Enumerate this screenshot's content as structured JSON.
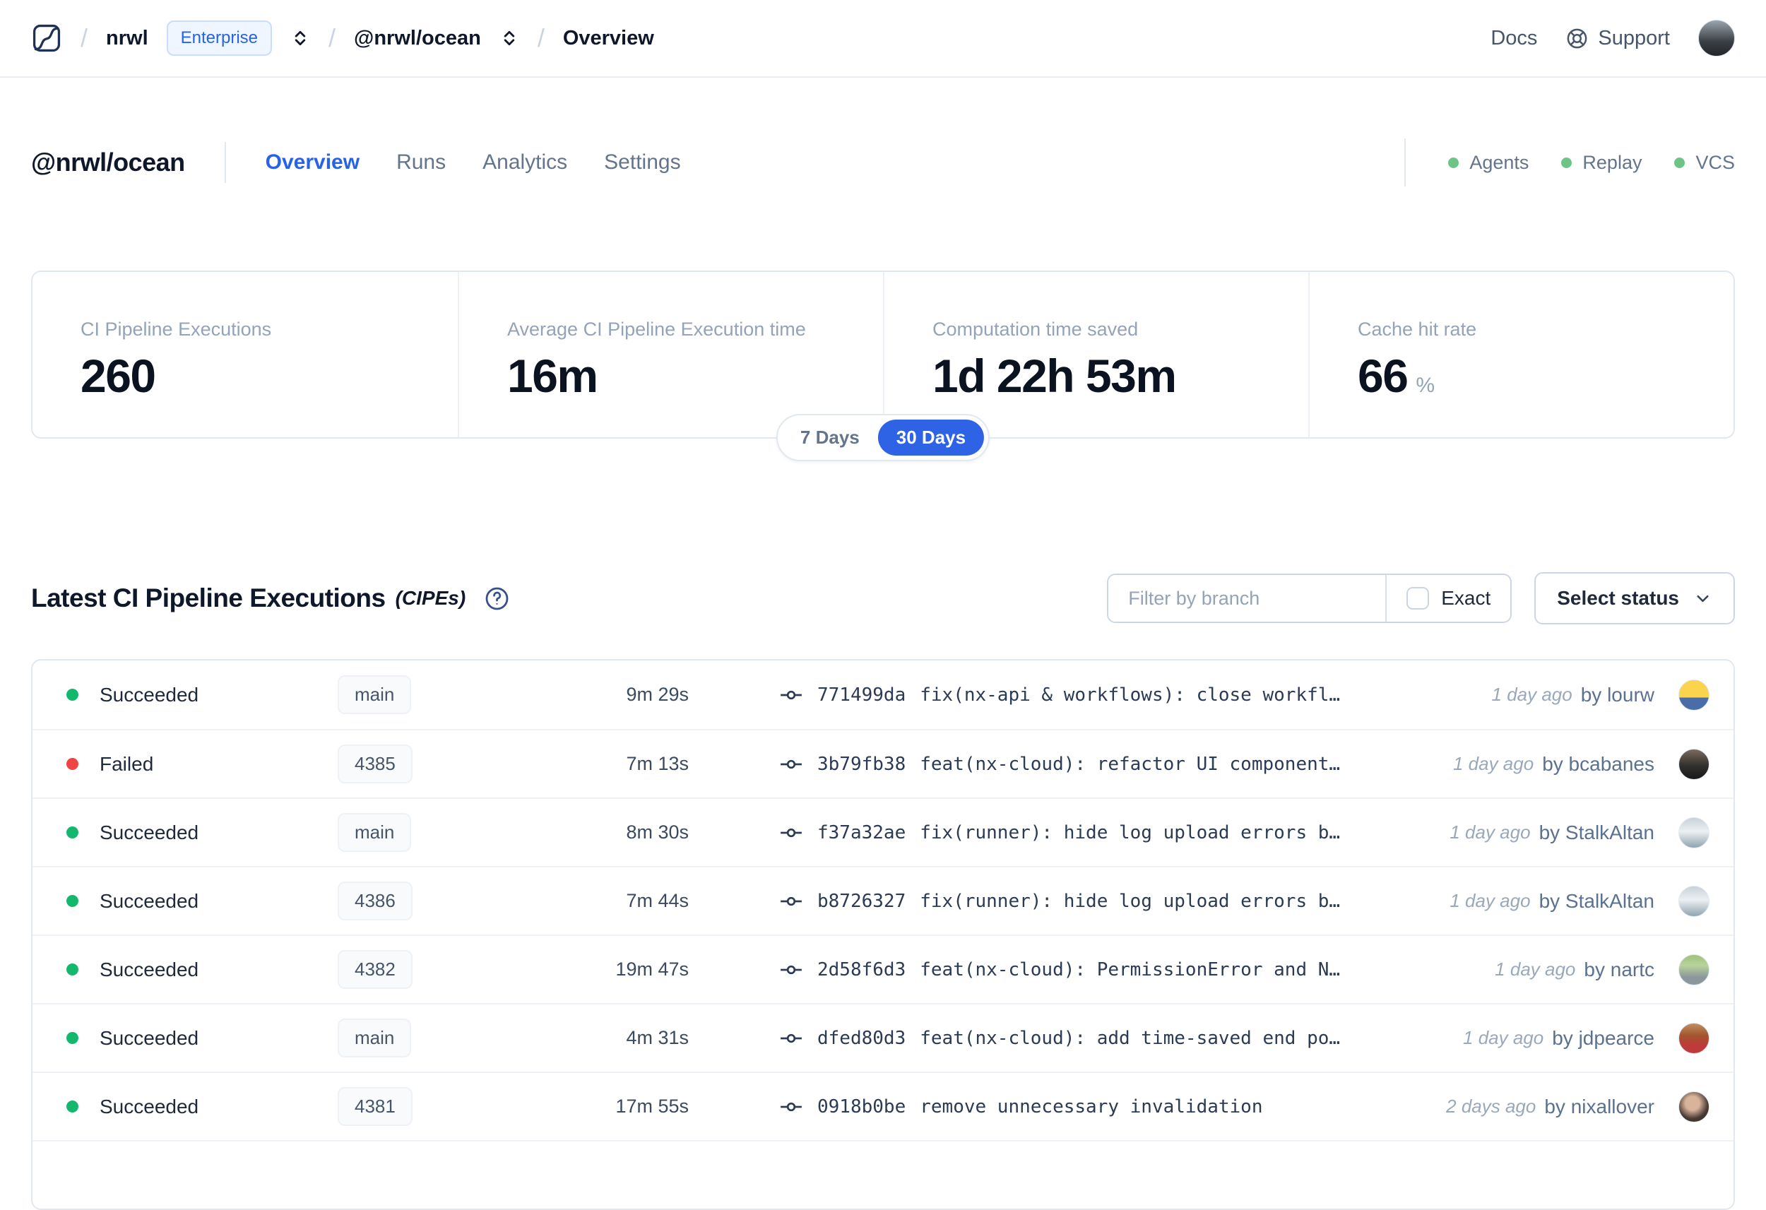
{
  "topbar": {
    "org": "nrwl",
    "org_badge": "Enterprise",
    "workspace": "@nrwl/ocean",
    "page": "Overview",
    "docs": "Docs",
    "support": "Support"
  },
  "header": {
    "title": "@nrwl/ocean",
    "tabs": [
      {
        "label": "Overview"
      },
      {
        "label": "Runs"
      },
      {
        "label": "Analytics"
      },
      {
        "label": "Settings"
      }
    ],
    "badges": [
      {
        "label": "Agents"
      },
      {
        "label": "Replay"
      },
      {
        "label": "VCS"
      }
    ],
    "badge_dot_color": "#6ec487"
  },
  "stats": {
    "cards": [
      {
        "label": "CI Pipeline Executions",
        "value": "260"
      },
      {
        "label": "Average CI Pipeline Execution time",
        "value": "16m"
      },
      {
        "label": "Computation time saved",
        "value": "1d 22h 53m"
      },
      {
        "label": "Cache hit rate",
        "value": "66",
        "suffix": "%"
      }
    ],
    "toggle": {
      "options": [
        "7 Days",
        "30 Days"
      ],
      "selected": "30 Days"
    }
  },
  "cipe": {
    "title": "Latest CI Pipeline Executions",
    "subtitle": "(CIPEs)",
    "filter_placeholder": "Filter by branch",
    "exact": "Exact",
    "select_status": "Select status",
    "rows": [
      {
        "status": "Succeeded",
        "dot_color": "#14b86d",
        "branch": "main",
        "duration": "9m 29s",
        "hash": "771499da",
        "message": "fix(nx-api & workflows): close workfl…",
        "time_ago": "1 day ago",
        "author": "by lourw",
        "avatar_bg": "linear-gradient(180deg,#fcd34d 58%,#4a6da7 58%)"
      },
      {
        "status": "Failed",
        "dot_color": "#ef4444",
        "branch": "4385",
        "duration": "7m 13s",
        "hash": "3b79fb38",
        "message": "feat(nx-cloud): refactor UI component…",
        "time_ago": "1 day ago",
        "author": "by bcabanes",
        "avatar_bg": "linear-gradient(180deg,#7a6a5c 0%,#32302e 55%,#17181a 100%)"
      },
      {
        "status": "Succeeded",
        "dot_color": "#14b86d",
        "branch": "main",
        "duration": "8m 30s",
        "hash": "f37a32ae",
        "message": "fix(runner): hide log upload errors b…",
        "time_ago": "1 day ago",
        "author": "by StalkAltan",
        "avatar_bg": "linear-gradient(180deg,#c8d2d8 0%,#ecf0f2 45%,#8fa3af 100%)"
      },
      {
        "status": "Succeeded",
        "dot_color": "#14b86d",
        "branch": "4386",
        "duration": "7m 44s",
        "hash": "b8726327",
        "message": "fix(runner): hide log upload errors b…",
        "time_ago": "1 day ago",
        "author": "by StalkAltan",
        "avatar_bg": "linear-gradient(180deg,#c8d2d8 0%,#ecf0f2 45%,#8fa3af 100%)"
      },
      {
        "status": "Succeeded",
        "dot_color": "#14b86d",
        "branch": "4382",
        "duration": "19m 47s",
        "hash": "2d58f6d3",
        "message": "feat(nx-cloud): PermissionError and N…",
        "time_ago": "1 day ago",
        "author": "by nartc",
        "avatar_bg": "linear-gradient(180deg,#9ec27b 0%,#b9d29a 35%,#8b979c 75%)"
      },
      {
        "status": "Succeeded",
        "dot_color": "#14b86d",
        "branch": "main",
        "duration": "4m 31s",
        "hash": "dfed80d3",
        "message": "feat(nx-cloud): add time-saved end po…",
        "time_ago": "1 day ago",
        "author": "by jdpearce",
        "avatar_bg": "linear-gradient(180deg,#c09063 0%,#a3552e 40%,#bf3a3a 75%)"
      },
      {
        "status": "Succeeded",
        "dot_color": "#14b86d",
        "branch": "4381",
        "duration": "17m 55s",
        "hash": "0918b0be",
        "message": "remove unnecessary invalidation",
        "time_ago": "2 days ago",
        "author": "by nixallover",
        "avatar_bg": "radial-gradient(circle at 45% 38%,#d9b49a 28%,#4a3c35 62%,#241f1e 100%)"
      }
    ]
  },
  "colors": {
    "accent": "#2e63e6",
    "success": "#14b86d",
    "danger": "#ef4444",
    "topbar_avatar_bg": "linear-gradient(180deg,#9aa5ad 0%,#3a3f44 60%,#23262a 100%)"
  }
}
